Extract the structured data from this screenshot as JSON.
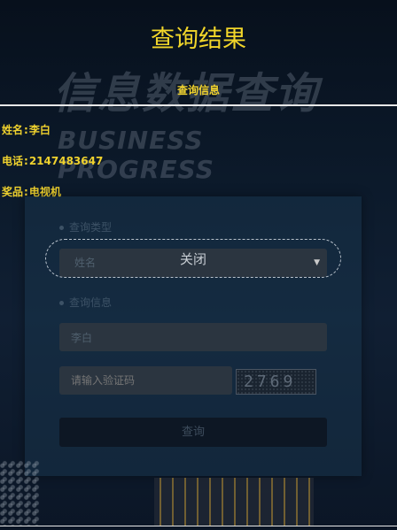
{
  "header": {
    "title": "查询结果",
    "section_title": "查询信息"
  },
  "background": {
    "watermark_cn": "信息数据查询",
    "watermark_en": "BUSINESS PROGRESS"
  },
  "results": [
    {
      "label": "姓名",
      "sep": ":",
      "value": "李白"
    },
    {
      "label": "电话",
      "sep": ":",
      "value": "2147483647"
    },
    {
      "label": "奖品",
      "sep": ":",
      "value": "电视机"
    }
  ],
  "form": {
    "query_type_label": "查询类型",
    "query_type_selected": "姓名",
    "query_info_label": "查询信息",
    "query_info_value": "李白",
    "captcha_placeholder": "请输入验证码",
    "captcha_text": "2769",
    "submit_label": "查询"
  },
  "overlay": {
    "close_label": "关闭"
  },
  "colors": {
    "accent": "#f1d52a",
    "background": "#0c1a2b"
  }
}
